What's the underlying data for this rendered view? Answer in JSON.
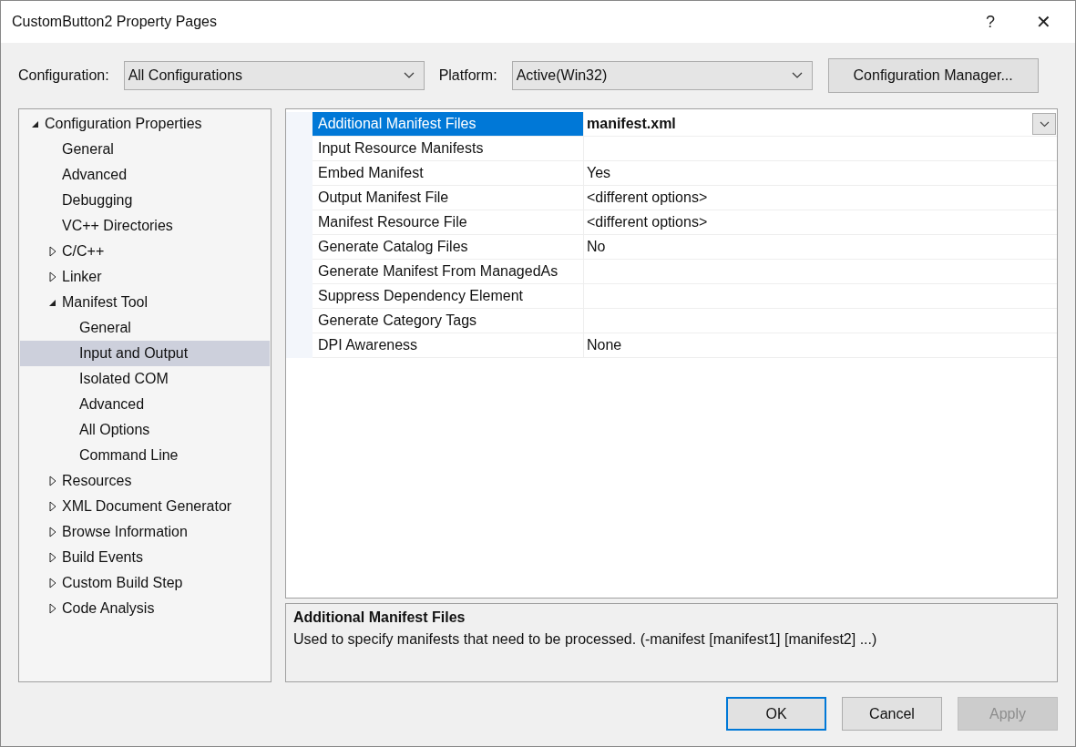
{
  "window": {
    "title": "CustomButton2 Property Pages",
    "help": "?",
    "close": "✕"
  },
  "configuration": {
    "label": "Configuration:",
    "value": "All Configurations"
  },
  "platform": {
    "label": "Platform:",
    "value": "Active(Win32)"
  },
  "config_manager_button": "Configuration Manager...",
  "tree": [
    {
      "label": "Configuration Properties",
      "expanded": true,
      "selected": false,
      "children": [
        {
          "label": "General",
          "selected": false
        },
        {
          "label": "Advanced",
          "selected": false
        },
        {
          "label": "Debugging",
          "selected": false
        },
        {
          "label": "VC++ Directories",
          "selected": false
        },
        {
          "label": "C/C++",
          "expanded": false,
          "selected": false
        },
        {
          "label": "Linker",
          "expanded": false,
          "selected": false
        },
        {
          "label": "Manifest Tool",
          "expanded": true,
          "selected": false,
          "children": [
            {
              "label": "General",
              "selected": false
            },
            {
              "label": "Input and Output",
              "selected": true
            },
            {
              "label": "Isolated COM",
              "selected": false
            },
            {
              "label": "Advanced",
              "selected": false
            },
            {
              "label": "All Options",
              "selected": false
            },
            {
              "label": "Command Line",
              "selected": false
            }
          ]
        },
        {
          "label": "Resources",
          "expanded": false,
          "selected": false
        },
        {
          "label": "XML Document Generator",
          "expanded": false,
          "selected": false
        },
        {
          "label": "Browse Information",
          "expanded": false,
          "selected": false
        },
        {
          "label": "Build Events",
          "expanded": false,
          "selected": false
        },
        {
          "label": "Custom Build Step",
          "expanded": false,
          "selected": false
        },
        {
          "label": "Code Analysis",
          "expanded": false,
          "selected": false
        }
      ]
    }
  ],
  "properties": [
    {
      "name": "Additional Manifest Files",
      "value": "manifest.xml",
      "selected": true,
      "modified": true
    },
    {
      "name": "Input Resource Manifests",
      "selected": false
    },
    {
      "name": "Embed Manifest",
      "value": "Yes",
      "selected": false,
      "modified": false
    },
    {
      "name": "Output Manifest File",
      "value": "<different options>",
      "selected": false,
      "modified": false
    },
    {
      "name": "Manifest Resource File",
      "value": "<different options>",
      "selected": false,
      "modified": false
    },
    {
      "name": "Generate Catalog Files",
      "value": "No",
      "selected": false,
      "modified": false
    },
    {
      "name": "Generate Manifest From ManagedAs",
      "selected": false
    },
    {
      "name": "Suppress Dependency Element",
      "selected": false
    },
    {
      "name": "Generate Category Tags",
      "selected": false
    },
    {
      "name": "DPI Awareness",
      "value": "None",
      "selected": false,
      "modified": false
    }
  ],
  "description": {
    "title": "Additional Manifest Files",
    "text": "Used to specify manifests that need to be processed. (-manifest [manifest1] [manifest2] ...)"
  },
  "buttons": [
    {
      "label": "OK",
      "default": true,
      "disabled": false
    },
    {
      "label": "Cancel",
      "default": false,
      "disabled": false
    },
    {
      "label": "Apply",
      "default": false,
      "disabled": true
    }
  ]
}
